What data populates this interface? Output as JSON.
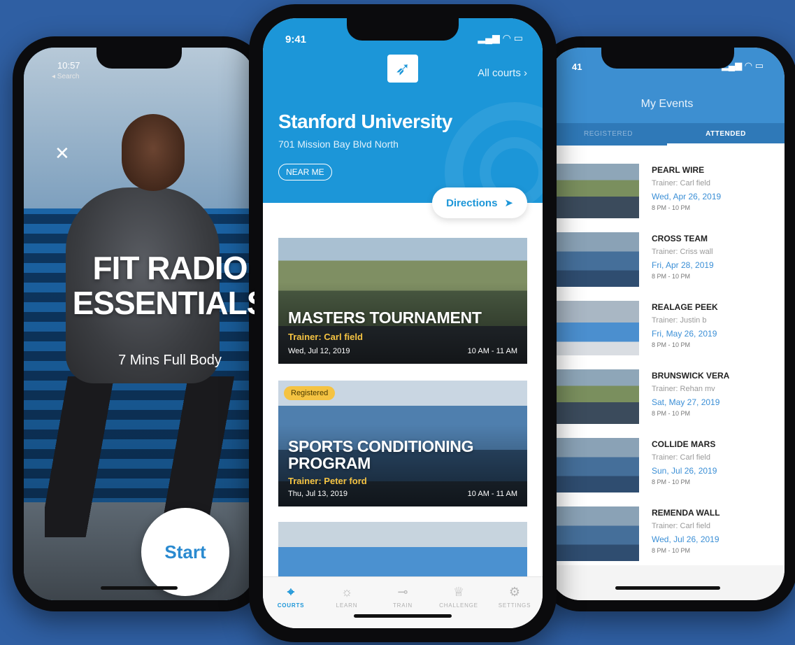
{
  "left_phone": {
    "status_time": "10:57",
    "back_label": "◂ Search",
    "workout_title": "FIT RADIO ESSENTIALS",
    "workout_sub": "7 Mins  Full Body",
    "start_label": "Start"
  },
  "center_phone": {
    "status_time": "9:41",
    "all_courts": "All courts",
    "venue_name": "Stanford University",
    "venue_address": "701 Mission Bay Blvd North",
    "near_me": "NEAR ME",
    "directions": "Directions",
    "cards": [
      {
        "title": "MASTERS TOURNAMENT",
        "trainer": "Trainer: Carl field",
        "date": "Wed, Jul 12, 2019",
        "time": "10 AM - 11 AM"
      },
      {
        "badge": "Registered",
        "title": "SPORTS CONDITIONING PROGRAM",
        "trainer": "Trainer: Peter ford",
        "date": "Thu, Jul 13, 2019",
        "time": "10 AM - 11 AM"
      }
    ],
    "tabs": [
      {
        "label": "COURTS",
        "icon": "location-pin-icon",
        "active": true
      },
      {
        "label": "LEARN",
        "icon": "lightbulb-icon",
        "active": false
      },
      {
        "label": "TRAIN",
        "icon": "whistle-icon",
        "active": false
      },
      {
        "label": "CHALLENGE",
        "icon": "trophy-icon",
        "active": false
      },
      {
        "label": "SETTINGS",
        "icon": "gear-icon",
        "active": false
      }
    ],
    "accent": "#1c96d8"
  },
  "right_phone": {
    "status_time": "41",
    "title": "My Events",
    "tabs": [
      "REGISTERED",
      "ATTENDED"
    ],
    "events": [
      {
        "name": "PEARL WIRE",
        "trainer": "Trainer: Carl field",
        "date": "Wed, Apr 26, 2019",
        "time": "8 PM - 10 PM"
      },
      {
        "name": "CROSS TEAM",
        "trainer": "Trainer: Criss wall",
        "date": "Fri, Apr 28, 2019",
        "time": "8 PM - 10 PM"
      },
      {
        "name": "REALAGE PEEK",
        "trainer": "Trainer: Justin b",
        "date": "Fri, May 26, 2019",
        "time": "8 PM - 10 PM"
      },
      {
        "name": "BRUNSWICK VERA",
        "trainer": "Trainer: Rehan mv",
        "date": "Sat, May 27, 2019",
        "time": "8 PM - 10 PM"
      },
      {
        "name": "COLLIDE MARS",
        "trainer": "Trainer: Carl field",
        "date": "Sun, Jul 26, 2019",
        "time": "8 PM - 10 PM"
      },
      {
        "name": "REMENDA WALL",
        "trainer": "Trainer: Carl field",
        "date": "Wed, Jul 26, 2019",
        "time": "8 PM - 10 PM"
      }
    ]
  }
}
